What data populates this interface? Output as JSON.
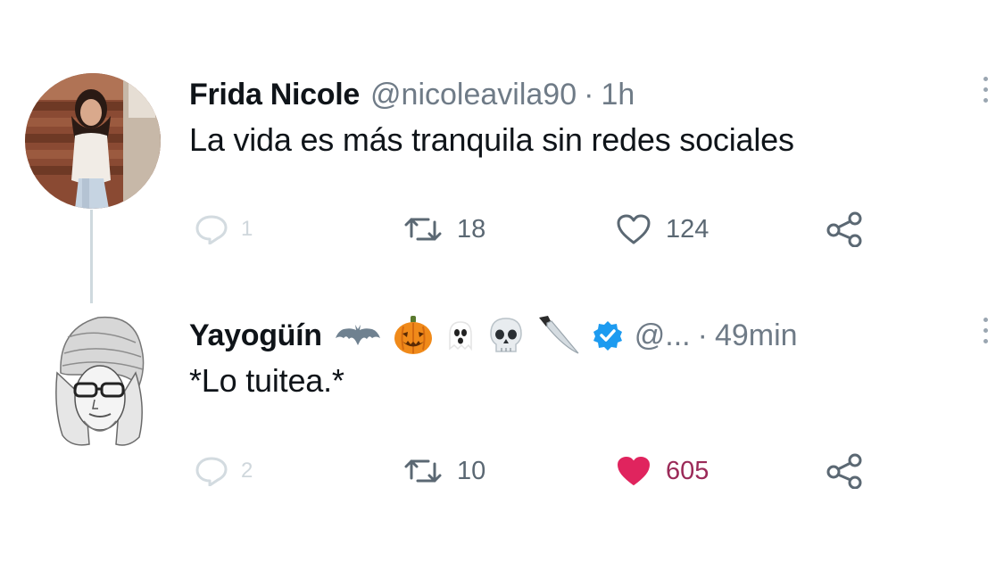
{
  "tweets": [
    {
      "name": "Frida Nicole",
      "handle": "@nicoleavila90",
      "separator": "·",
      "time": "1h",
      "text": "La vida es más tranquila sin redes sociales",
      "replies": "1",
      "retweets": "18",
      "likes": "124",
      "liked": false
    },
    {
      "name": "Yayogüín",
      "emojis": [
        "bat-icon",
        "jack-o-lantern-icon",
        "ghost-icon",
        "skull-icon",
        "knife-icon",
        "verified-badge-icon"
      ],
      "handle": "@...",
      "separator": "·",
      "time": "49min",
      "text": "*Lo tuitea.*",
      "replies": "2",
      "retweets": "10",
      "likes": "605",
      "liked": true
    }
  ],
  "colors": {
    "name": "#0f1419",
    "muted": "#6f7b87",
    "like_active": "#e0245e",
    "verified": "#1d9bf0",
    "thread_line": "#cfd9de"
  }
}
